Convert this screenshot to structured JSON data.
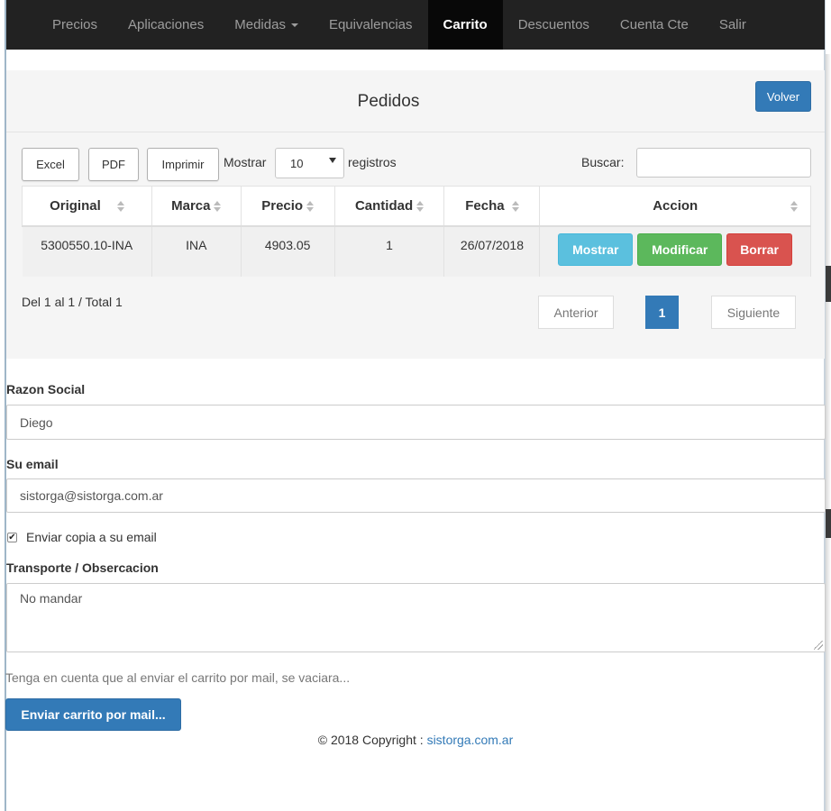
{
  "nav": {
    "items": [
      {
        "label": "Precios",
        "active": false
      },
      {
        "label": "Aplicaciones",
        "active": false
      },
      {
        "label": "Medidas",
        "active": false,
        "dropdown": true
      },
      {
        "label": "Equivalencias",
        "active": false
      },
      {
        "label": "Carrito",
        "active": true
      },
      {
        "label": "Descuentos",
        "active": false
      },
      {
        "label": "Cuenta Cte",
        "active": false
      },
      {
        "label": "Salir",
        "active": false
      }
    ]
  },
  "panel": {
    "title": "Pedidos",
    "back_label": "Volver"
  },
  "toolbar": {
    "excel_label": "Excel",
    "pdf_label": "PDF",
    "print_label": "Imprimir",
    "show_label": "Mostrar",
    "page_size": "10",
    "records_label": "registros",
    "search_label": "Buscar:",
    "search_value": ""
  },
  "table": {
    "headers": [
      "Original",
      "Marca",
      "Precio",
      "Cantidad",
      "Fecha",
      "Accion"
    ],
    "rows": [
      {
        "original": "5300550.10-INA",
        "marca": "INA",
        "precio": "4903.05",
        "cantidad": "1",
        "fecha": "26/07/2018",
        "actions": {
          "show": "Mostrar",
          "edit": "Modificar",
          "delete": "Borrar"
        }
      }
    ]
  },
  "pagination": {
    "info": "Del 1 al 1 / Total 1",
    "prev": "Anterior",
    "current": "1",
    "next": "Siguiente"
  },
  "form": {
    "razon_label": "Razon Social",
    "razon_value": "Diego",
    "email_label": "Su email",
    "email_value": "sistorga@sistorga.com.ar",
    "copy_label": "Enviar copia a su email",
    "copy_checked": true,
    "transport_label": "Transporte / Obsercacion",
    "transport_value": "No mandar",
    "notice": "Tenga en cuenta que al enviar el carrito por mail, se vaciara...",
    "submit_label": "Enviar carrito por mail..."
  },
  "footer": {
    "copyright": "© 2018 Copyright :",
    "link": "sistorga.com.ar"
  },
  "colors": {
    "navbar_bg": "#222222",
    "primary": "#337ab7",
    "info": "#5bc0de",
    "success": "#5cb85c",
    "danger": "#d9534f"
  }
}
